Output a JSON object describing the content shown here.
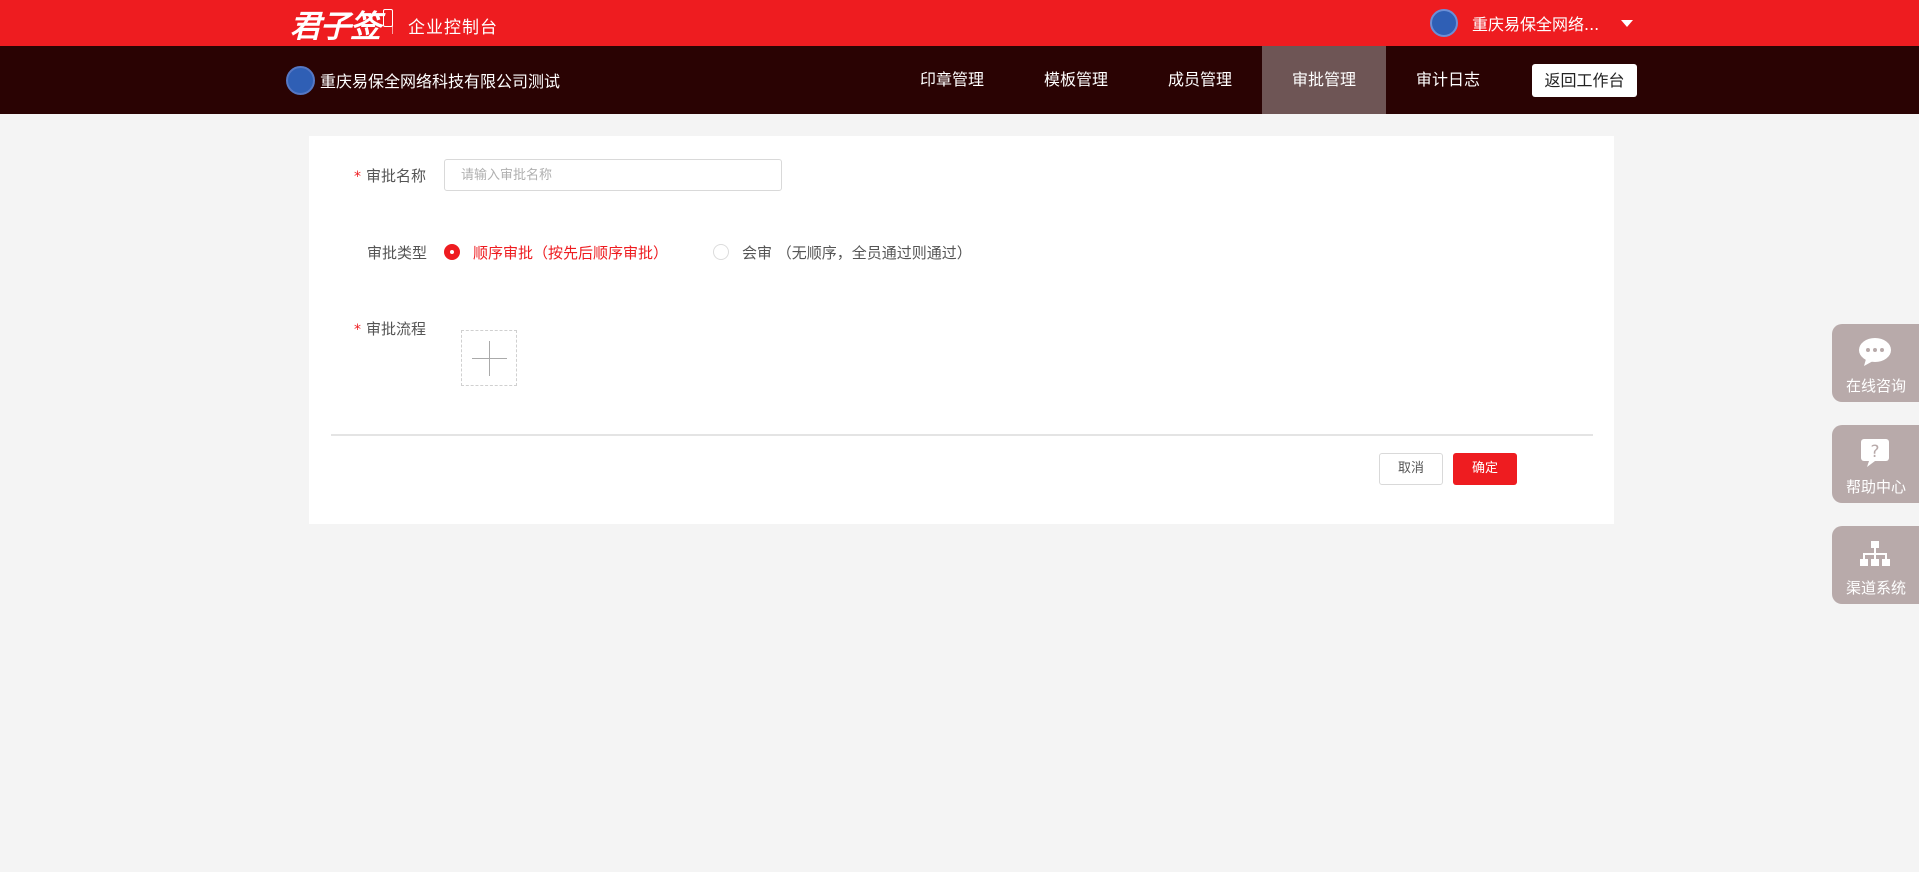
{
  "header": {
    "logo_text": "君子签",
    "console_title": "企业控制台",
    "user_name": "重庆易保全网络..."
  },
  "nav": {
    "company_name": "重庆易保全网络科技有限公司测试",
    "tabs": [
      {
        "label": "印章管理",
        "active": false
      },
      {
        "label": "模板管理",
        "active": false
      },
      {
        "label": "成员管理",
        "active": false
      },
      {
        "label": "审批管理",
        "active": true
      },
      {
        "label": "审计日志",
        "active": false
      }
    ],
    "back_label": "返回工作台"
  },
  "form": {
    "required_mark": "*",
    "name_label": "审批名称",
    "name_placeholder": "请输入审批名称",
    "name_value": "",
    "type_label": "审批类型",
    "type_options": [
      {
        "label": "顺序审批（按先后顺序审批）",
        "selected": true
      },
      {
        "label": "会审 （无顺序，全员通过则通过）",
        "selected": false
      }
    ],
    "flow_label": "审批流程",
    "cancel_label": "取消",
    "confirm_label": "确定"
  },
  "float_widgets": [
    {
      "label": "在线咨询",
      "icon": "chat-bubble-icon"
    },
    {
      "label": "帮助中心",
      "icon": "question-icon"
    },
    {
      "label": "渠道系统",
      "icon": "org-chart-icon"
    }
  ],
  "colors": {
    "brand_red": "#ee1c20",
    "nav_dark": "#2a0303",
    "active_tab": "#6e5555",
    "widget_bg": "#b8aaaa"
  }
}
